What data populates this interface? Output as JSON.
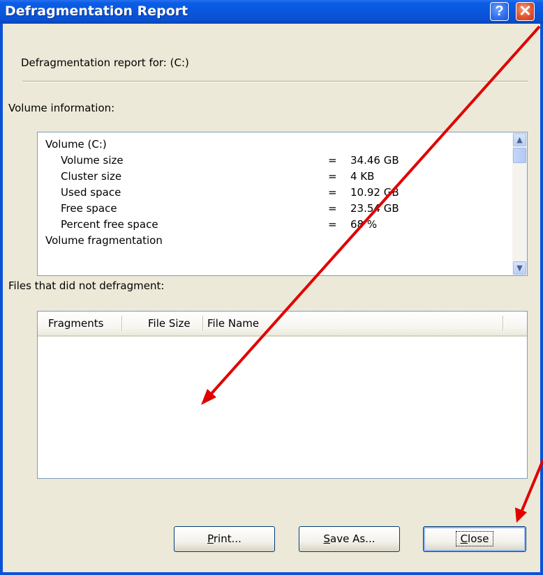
{
  "window": {
    "title": "Defragmentation Report",
    "help_glyph": "?",
    "close_glyph": "✕"
  },
  "report": {
    "heading": "Defragmentation report for:  (C:)",
    "volume_info_label": "Volume information:",
    "volume_info": [
      {
        "name": "Volume  (C:)",
        "eq": "",
        "value": ""
      },
      {
        "name": "Volume size",
        "eq": "=",
        "value": "34.46 GB"
      },
      {
        "name": "Cluster size",
        "eq": "=",
        "value": "4 KB"
      },
      {
        "name": "Used space",
        "eq": "=",
        "value": "10.92 GB"
      },
      {
        "name": "Free space",
        "eq": "=",
        "value": "23.54 GB"
      },
      {
        "name": "Percent free space",
        "eq": "=",
        "value": "68 %"
      },
      {
        "name": "Volume fragmentation",
        "eq": "",
        "value": ""
      }
    ],
    "files_label": "Files that did not defragment:",
    "columns": [
      "Fragments",
      "File Size",
      "File Name"
    ]
  },
  "buttons": {
    "print": {
      "pre": "",
      "accel": "P",
      "post": "rint..."
    },
    "save_as": {
      "pre": "",
      "accel": "S",
      "post": "ave As..."
    },
    "close": {
      "pre": "",
      "accel": "C",
      "post": "lose"
    }
  },
  "icons": {
    "scroll_up": "up-arrow",
    "scroll_down": "down-arrow",
    "annotation_color": "#e00000"
  }
}
